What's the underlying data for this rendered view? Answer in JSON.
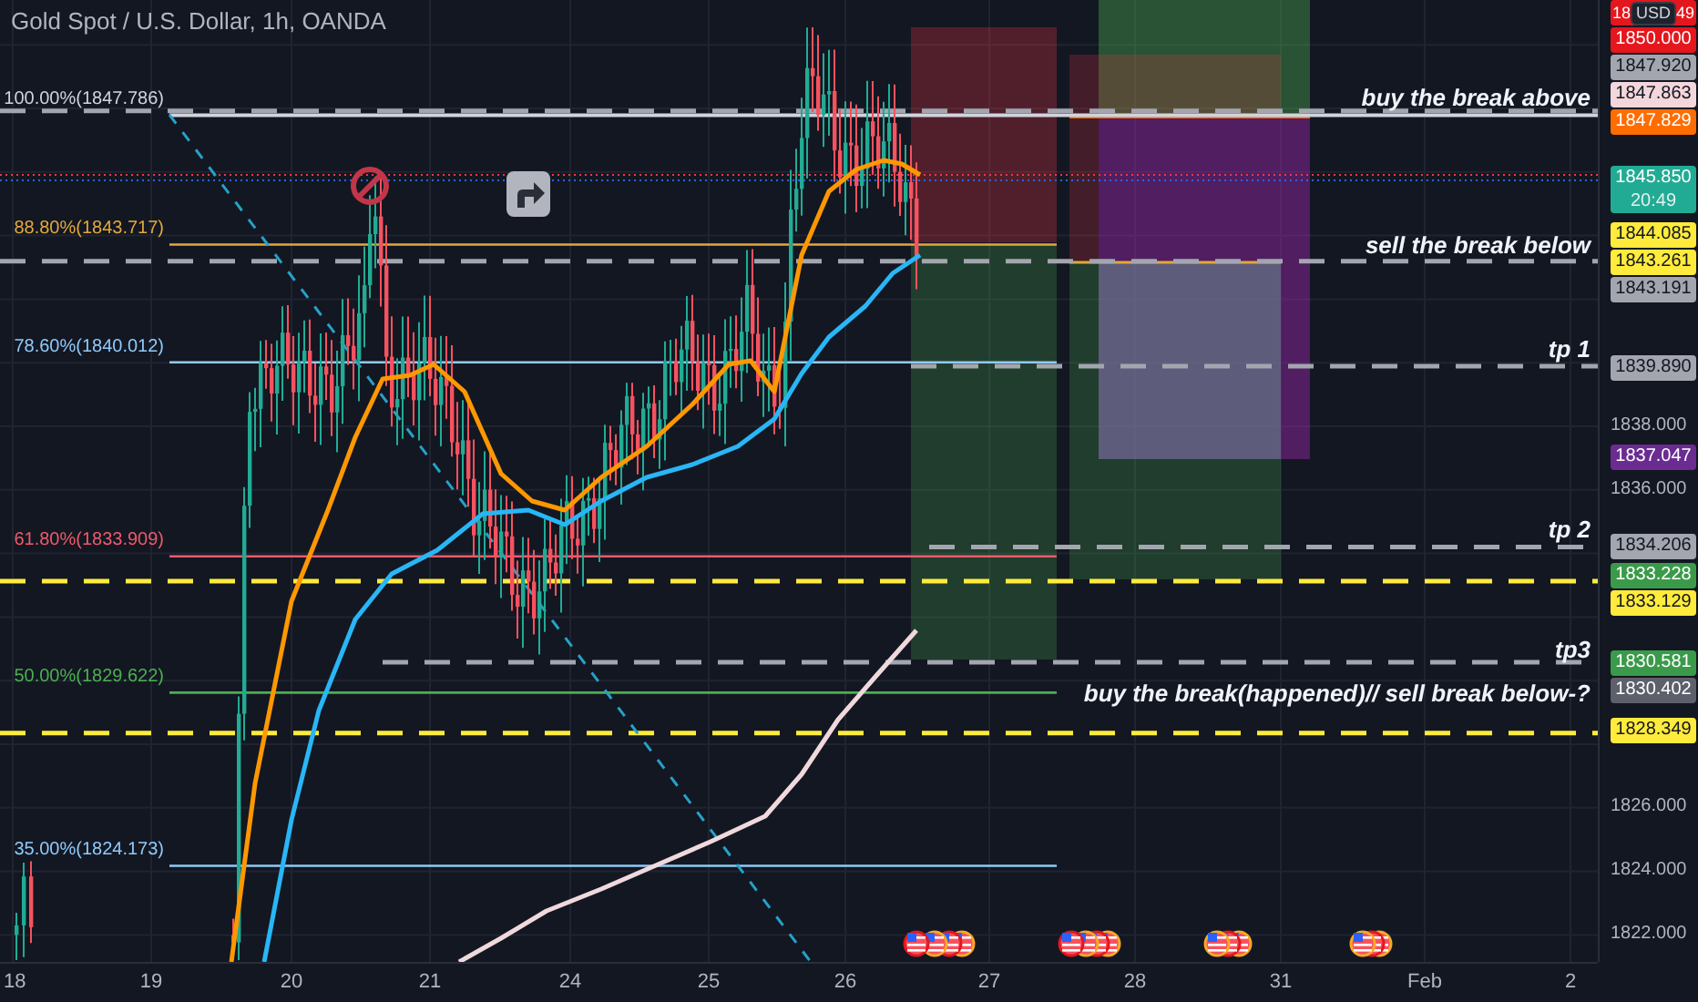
{
  "chart": {
    "title": "Gold Spot / U.S. Dollar, 1h, OANDA",
    "currency_button": "USD",
    "fib_levels": [
      {
        "label": "100.00%(1847.786)",
        "color": "#d1d4dc"
      },
      {
        "label": "88.80%(1843.717)",
        "color": "#e3a83b"
      },
      {
        "label": "78.60%(1840.012)",
        "color": "#90caf9"
      },
      {
        "label": "61.80%(1833.909)",
        "color": "#f05a6a"
      },
      {
        "label": "50.00%(1829.622)",
        "color": "#4caf50"
      },
      {
        "label": "35.00%(1824.173)",
        "color": "#90caf9"
      }
    ],
    "annotations": [
      "buy the break above",
      "sell the break below",
      "tp 1",
      "tp 2",
      "tp3",
      "buy the break(happened)// sell break below-?"
    ],
    "price_tags": [
      {
        "kind": "covered",
        "parts": [
          "18",
          "49"
        ],
        "color": "#e5161d"
      },
      {
        "kind": "price",
        "text": "1850.000",
        "color": "#e5161d"
      },
      {
        "kind": "price",
        "text": "1847.920",
        "color": "#a3a6af"
      },
      {
        "kind": "price",
        "text": "1847.863",
        "color": "#f3d6dc"
      },
      {
        "kind": "price",
        "text": "1847.829",
        "color": "#ff6d00"
      },
      {
        "kind": "countdown",
        "text": "1845.850",
        "time": "20:49",
        "color": "#22ab94"
      },
      {
        "kind": "price",
        "text": "1844.085",
        "color": "#ffeb3b"
      },
      {
        "kind": "price",
        "text": "1843.261",
        "color": "#ffeb3b"
      },
      {
        "kind": "price",
        "text": "1843.191",
        "color": "#a3a6af"
      },
      {
        "kind": "price",
        "text": "1839.890",
        "color": "#a3a6af"
      },
      {
        "kind": "price",
        "text": "1837.047",
        "color": "#6a2c91"
      },
      {
        "kind": "price",
        "text": "1834.206",
        "color": "#a3a6af"
      },
      {
        "kind": "price",
        "text": "1833.228",
        "color": "#3b9a4a"
      },
      {
        "kind": "price",
        "text": "1833.129",
        "color": "#ffeb3b"
      },
      {
        "kind": "price",
        "text": "1830.581",
        "color": "#3b9a4a"
      },
      {
        "kind": "price",
        "text": "1830.402",
        "color": "#5d606b"
      },
      {
        "kind": "price",
        "text": "1828.349",
        "color": "#ffeb3b"
      }
    ],
    "price_axis": {
      "ticks": [
        "1838.000",
        "1836.000",
        "1826.000",
        "1824.000",
        "1822.000"
      ]
    },
    "time_axis": {
      "ticks": [
        "18",
        "19",
        "20",
        "21",
        "24",
        "25",
        "26",
        "27",
        "28",
        "31",
        "Feb",
        "2"
      ]
    }
  }
}
